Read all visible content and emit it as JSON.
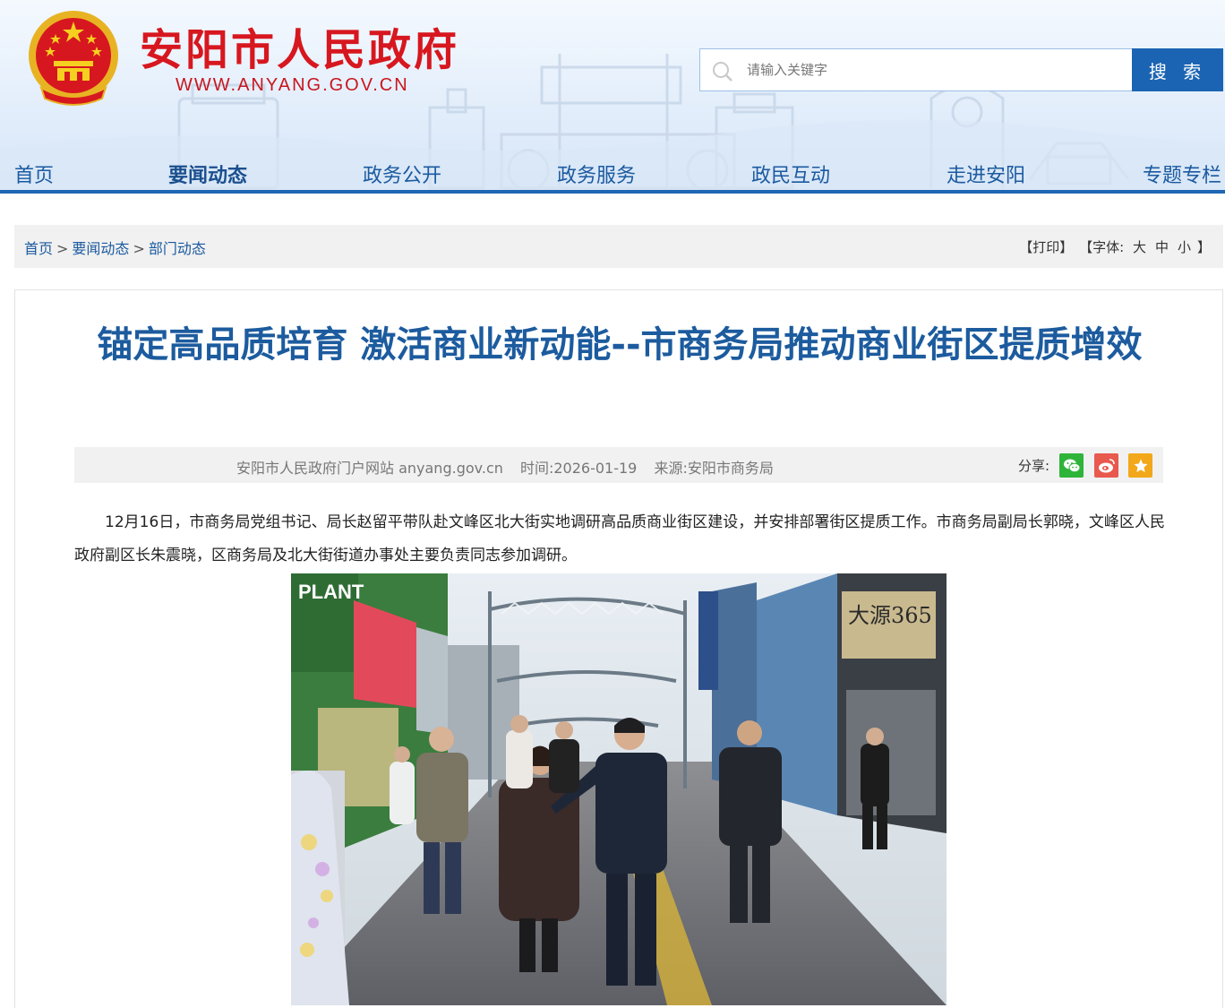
{
  "header": {
    "site_title": "安阳市人民政府",
    "site_url": "WWW.ANYANG.GOV.CN",
    "search": {
      "placeholder": "请输入关键字",
      "button_label": "搜 索"
    },
    "nav": [
      {
        "label": "首页",
        "active": false
      },
      {
        "label": "要闻动态",
        "active": true
      },
      {
        "label": "政务公开",
        "active": false
      },
      {
        "label": "政务服务",
        "active": false
      },
      {
        "label": "政民互动",
        "active": false
      },
      {
        "label": "走进安阳",
        "active": false
      },
      {
        "label": "专题专栏",
        "active": false
      }
    ],
    "colors": {
      "title_red": "#d7171f",
      "nav_blue": "#1f66b4",
      "search_button": "#1b64b3"
    }
  },
  "breadcrumb": {
    "items": [
      "首页",
      "要闻动态",
      "部门动态"
    ],
    "separator": ">"
  },
  "tools": {
    "print": "【打印】",
    "font_open": "【字体:",
    "font_large": "大",
    "font_medium": "中",
    "font_small": "小",
    "font_close": "】"
  },
  "article": {
    "title": "锚定高品质培育 激活商业新动能--市商务局推动商业街区提质增效",
    "meta": {
      "publisher": "安阳市人民政府门户网站 anyang.gov.cn",
      "time": "时间:2026-01-19",
      "source": "来源:安阳市商务局"
    },
    "share_label": "分享:",
    "share_icons": [
      "wechat-icon",
      "weibo-icon",
      "favorite-star-icon"
    ],
    "body": "12月16日，市商务局党组书记、局长赵留平带队赴文峰区北大街实地调研高品质商业街区建设，并安排部署街区提质工作。市商务局副局长郭晓，文峰区人民政府副区长朱震晓，区商务局及北大街街道办事处主要负责同志参加调研。",
    "photo_signs": [
      "PLANT",
      "大源365"
    ]
  }
}
